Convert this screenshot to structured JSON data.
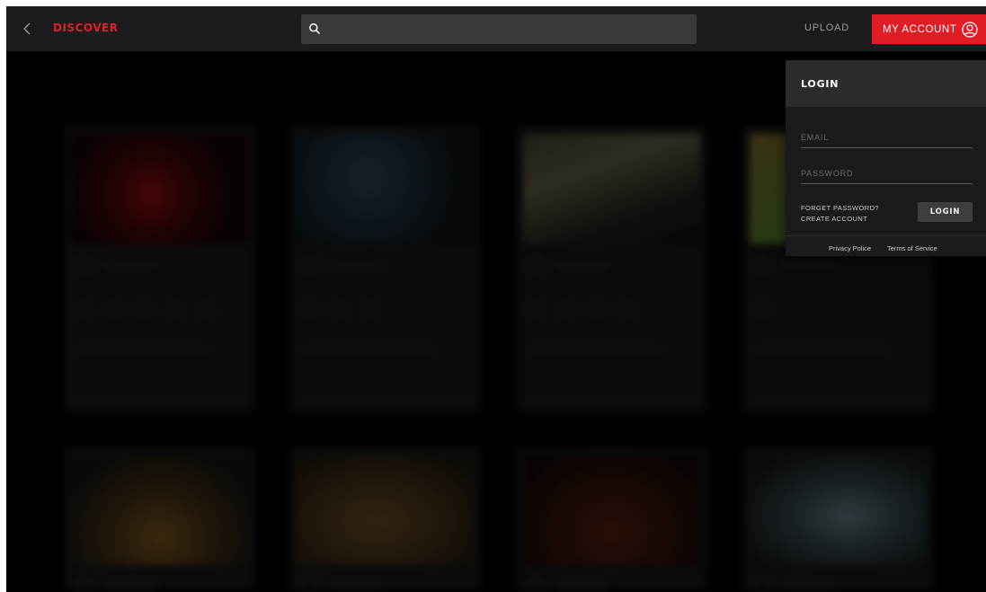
{
  "topbar": {
    "back_icon": "chevron-left-icon",
    "brand": "DISCOVER",
    "search": {
      "value": "",
      "placeholder": "",
      "icon": "search-icon"
    },
    "upload_label": "UPLOAD",
    "account_label": "MY ACCOUNT",
    "account_icon": "user-circle-icon"
  },
  "login": {
    "title": "LOGIN",
    "email_placeholder": "EMAIL",
    "password_placeholder": "PASSWORD",
    "forgot_label": "FORGET PASSWORD?",
    "create_label": "CREATE ACCOUNT",
    "submit_label": "LOGIN",
    "privacy_label": "Privacy Police",
    "terms_label": "Terms of Service"
  },
  "colors": {
    "accent": "#e11c24",
    "topbar_bg": "#1c1c1e",
    "panel_bg": "#1b1b1d",
    "panel_header_bg": "#2c2c2e",
    "background": "#000000"
  }
}
